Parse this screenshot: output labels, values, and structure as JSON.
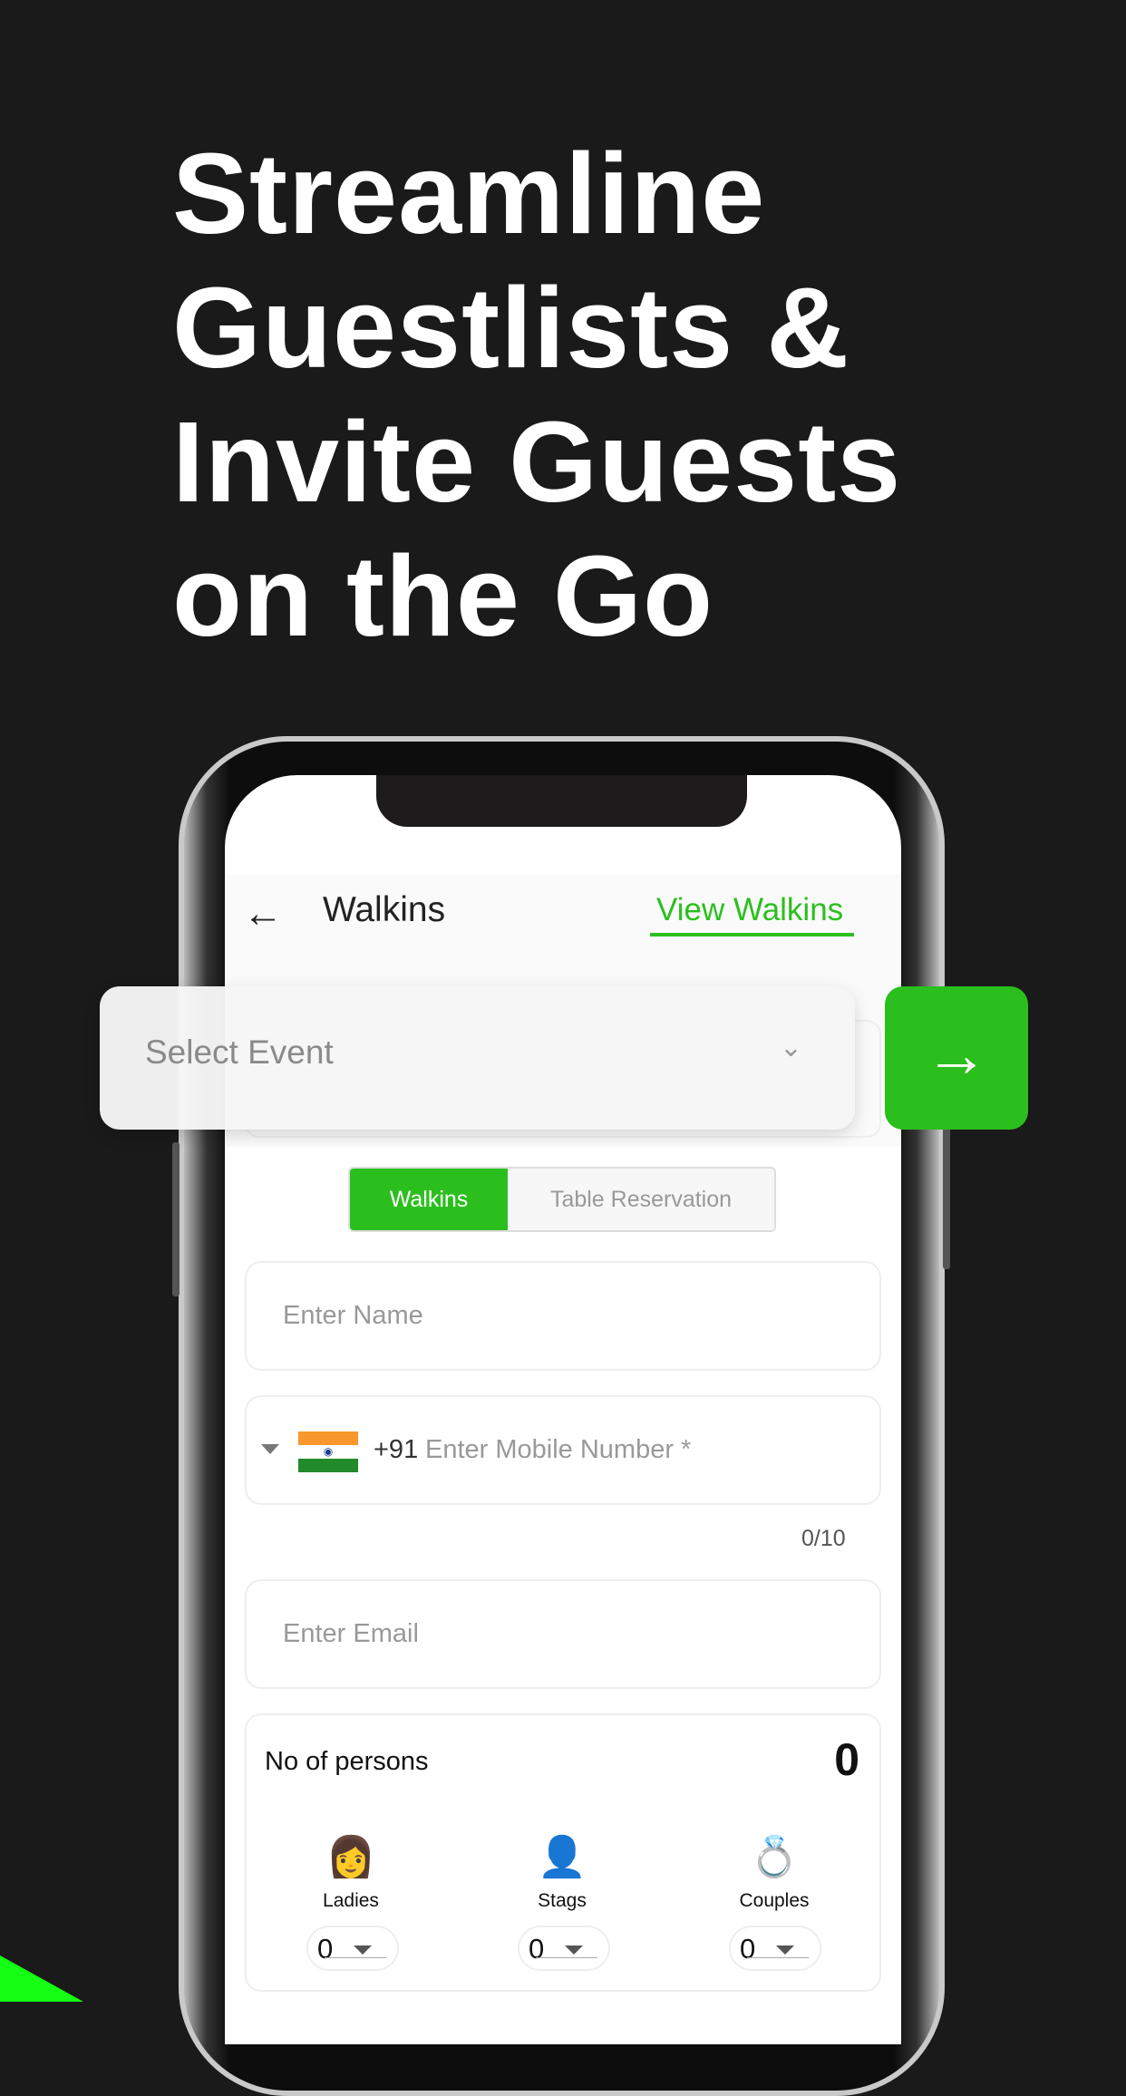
{
  "headline": [
    "Streamline",
    "Guestlists &",
    "Invite Guests",
    "on the Go"
  ],
  "colors": {
    "accent": "#2bbf1e",
    "background": "#1a1a1a",
    "corner": "#15ff15"
  },
  "app": {
    "back_icon": "arrow-left",
    "title": "Walkins",
    "view_link": "View Walkins",
    "select_event": {
      "placeholder": "Select Event",
      "icon": "chevron-down"
    },
    "go_icon": "arrow-right",
    "tabs": [
      {
        "label": "Walkins",
        "active": true
      },
      {
        "label": "Table Reservation",
        "active": false
      }
    ],
    "name_placeholder": "Enter Name",
    "phone": {
      "country_code": "+91",
      "flag": "India",
      "placeholder": "Enter Mobile Number *",
      "counter": "0/10"
    },
    "email_placeholder": "Enter Email",
    "persons": {
      "label": "No of persons",
      "total": "0",
      "categories": [
        {
          "label": "Ladies",
          "value": "0",
          "icon": "woman"
        },
        {
          "label": "Stags",
          "value": "0",
          "icon": "man"
        },
        {
          "label": "Couples",
          "value": "0",
          "icon": "rings"
        }
      ]
    }
  }
}
